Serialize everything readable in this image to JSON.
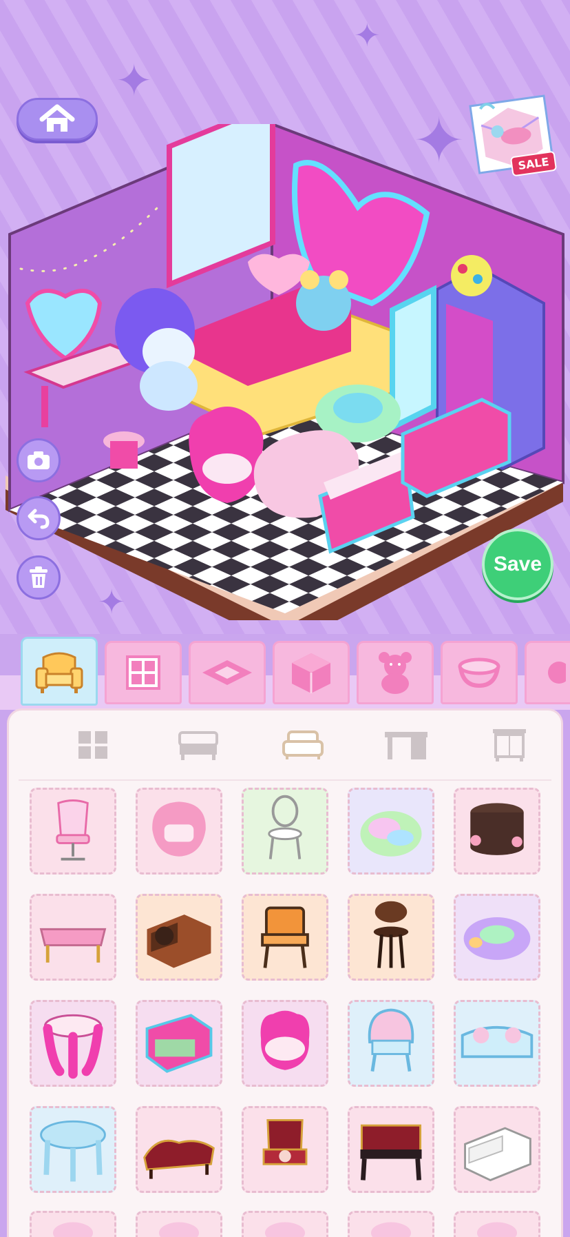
{
  "header": {
    "home_icon": "home-icon",
    "sale_label": "SALE"
  },
  "side_tools": [
    {
      "name": "camera",
      "icon": "camera-icon"
    },
    {
      "name": "undo",
      "icon": "undo-icon"
    },
    {
      "name": "delete",
      "icon": "trash-icon"
    }
  ],
  "save_label": "Save",
  "category_tabs": [
    {
      "icon": "armchair-icon",
      "active": true
    },
    {
      "icon": "window-icon",
      "active": false
    },
    {
      "icon": "rug-icon",
      "active": false
    },
    {
      "icon": "wall-cube-icon",
      "active": false
    },
    {
      "icon": "teddy-bear-icon",
      "active": false
    },
    {
      "icon": "bowl-icon",
      "active": false
    },
    {
      "icon": "partial-tab-icon",
      "active": false
    }
  ],
  "sub_tabs": [
    {
      "icon": "grid-all-icon",
      "active": false
    },
    {
      "icon": "bed-icon",
      "active": false
    },
    {
      "icon": "sofa-icon",
      "active": true
    },
    {
      "icon": "desk-icon",
      "active": false
    },
    {
      "icon": "wardrobe-icon",
      "active": false
    }
  ],
  "items": [
    {
      "name": "pink-gaming-chair",
      "bg": "#fbe0ea"
    },
    {
      "name": "pink-egg-chair",
      "bg": "#fbe0ea"
    },
    {
      "name": "white-bistro-chair",
      "bg": "#e6f6df"
    },
    {
      "name": "rainbow-beanbag",
      "bg": "#e9e6fb"
    },
    {
      "name": "rose-ottoman",
      "bg": "#fbe0ea"
    },
    {
      "name": "pink-tufted-bench",
      "bg": "#fbe0ea"
    },
    {
      "name": "brown-leather-sofa",
      "bg": "#fde5d3"
    },
    {
      "name": "wooden-armchair",
      "bg": "#fde5d3"
    },
    {
      "name": "bar-stool",
      "bg": "#fde5d3"
    },
    {
      "name": "rainbow-ring-cushion",
      "bg": "#efe0f8"
    },
    {
      "name": "pink-stool",
      "bg": "#f6ddf0"
    },
    {
      "name": "storage-bench",
      "bg": "#f6ddf0"
    },
    {
      "name": "hand-chair",
      "bg": "#f6ddf0"
    },
    {
      "name": "shell-chair",
      "bg": "#dff0fa"
    },
    {
      "name": "shell-sofa",
      "bg": "#dff0fa"
    },
    {
      "name": "ice-table",
      "bg": "#dff0fa"
    },
    {
      "name": "red-chaise",
      "bg": "#fbe0ea"
    },
    {
      "name": "red-throne-chair",
      "bg": "#fbe0ea"
    },
    {
      "name": "red-ottoman-table",
      "bg": "#fbe0ea"
    },
    {
      "name": "white-sofa",
      "bg": "#fbe0ea"
    },
    {
      "name": "partial-item-1",
      "bg": "#fbe0ea"
    },
    {
      "name": "partial-item-2",
      "bg": "#fbe0ea"
    },
    {
      "name": "partial-item-3",
      "bg": "#fbe0ea"
    },
    {
      "name": "partial-item-4",
      "bg": "#fbe0ea"
    },
    {
      "name": "partial-item-5",
      "bg": "#fbe0ea"
    }
  ],
  "colors": {
    "accent": "#a98ff0",
    "save": "#3ecf78",
    "tab": "#f7b8de",
    "active_tab": "#cfeefa"
  }
}
